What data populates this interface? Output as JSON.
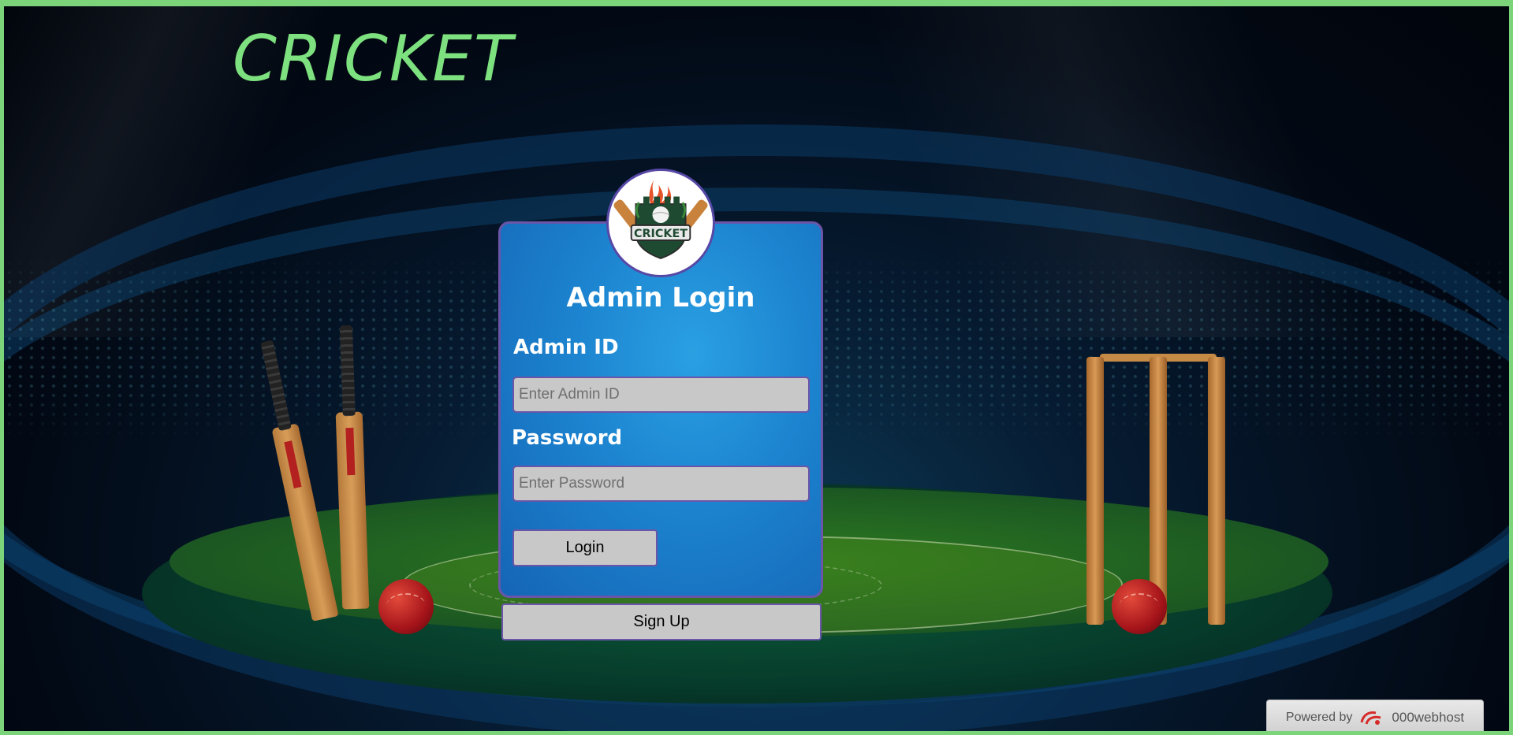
{
  "header": {
    "brand": "CRICKET"
  },
  "card": {
    "title": "Admin Login",
    "logo_icon": "cricket-shield-logo",
    "logo_text": "CRICKET",
    "admin_id_label": "Admin ID",
    "admin_id_placeholder": "Enter Admin ID",
    "admin_id_value": "",
    "password_label": "Password",
    "password_placeholder": "Enter Password",
    "password_value": "",
    "login_label": "Login"
  },
  "signup_label": "Sign Up",
  "footer": {
    "powered_by": "Powered by",
    "host_name": "000webhost",
    "host_icon": "000webhost-logo-icon"
  },
  "colors": {
    "brand_green": "#7ee17f",
    "card_blue": "#1c83cf",
    "border_purple": "#6a55a8",
    "input_gray": "#c8c8c8"
  }
}
